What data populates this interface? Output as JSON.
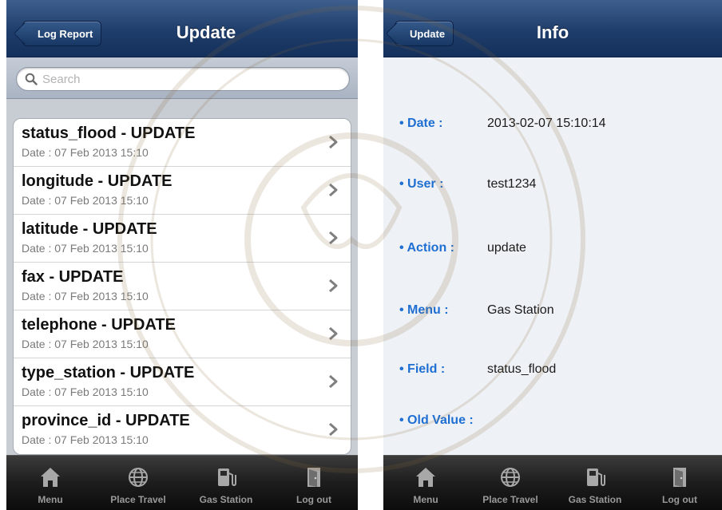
{
  "colors": {
    "navbar": "#1f3d6b",
    "info_label": "#1f6fd2",
    "tabbar": "#1d1d1d",
    "list_background": "#c8ccd3"
  },
  "left_screen": {
    "navbar": {
      "back_label": "Log Report",
      "title": "Update"
    },
    "search": {
      "placeholder": "Search",
      "icon": "search-icon"
    },
    "rows": [
      {
        "title": "status_flood - UPDATE",
        "date": "Date : 07 Feb 2013 15:10"
      },
      {
        "title": "longitude - UPDATE",
        "date": "Date : 07 Feb 2013 15:10"
      },
      {
        "title": "latitude - UPDATE",
        "date": "Date : 07 Feb 2013 15:10"
      },
      {
        "title": "fax - UPDATE",
        "date": "Date : 07 Feb 2013 15:10"
      },
      {
        "title": "telephone - UPDATE",
        "date": "Date : 07 Feb 2013 15:10"
      },
      {
        "title": "type_station - UPDATE",
        "date": "Date : 07 Feb 2013 15:10"
      },
      {
        "title": "province_id - UPDATE",
        "date": "Date : 07 Feb 2013 15:10"
      }
    ]
  },
  "right_screen": {
    "navbar": {
      "back_label": "Update",
      "title": "Info"
    },
    "fields": {
      "date": {
        "label": "• Date :",
        "value": "2013-02-07 15:10:14"
      },
      "user": {
        "label": "• User :",
        "value": "test1234"
      },
      "action": {
        "label": "• Action :",
        "value": "update"
      },
      "menu": {
        "label": "• Menu :",
        "value": "Gas Station"
      },
      "field": {
        "label": "• Field :",
        "value": "status_flood"
      },
      "old_value": {
        "label": "• Old Value :",
        "value": ""
      }
    }
  },
  "tabbar": {
    "tabs": [
      {
        "label": "Menu",
        "icon": "home-icon"
      },
      {
        "label": "Place Travel",
        "icon": "globe-icon"
      },
      {
        "label": "Gas Station",
        "icon": "fuel-pump-icon"
      },
      {
        "label": "Log out",
        "icon": "door-exit-icon"
      }
    ]
  }
}
